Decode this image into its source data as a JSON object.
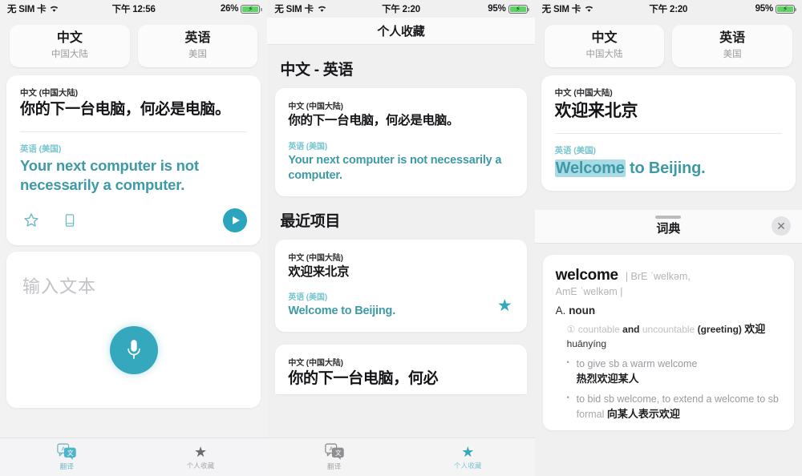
{
  "panels": [
    {
      "status": {
        "carrier": "无 SIM 卡",
        "time": "下午 12:56",
        "battery": "26%"
      },
      "lang_from": {
        "name": "中文",
        "region": "中国大陆"
      },
      "lang_to": {
        "name": "英语",
        "region": "美国"
      },
      "card": {
        "source_label": "中文 (中国大陆)",
        "source_text": "你的下一台电脑，何必是电脑。",
        "target_label": "英语 (美国)",
        "target_text": "Your next computer is not necessarily a computer."
      },
      "actions": {
        "favorite": "star-outline-icon",
        "dictionary": "book-icon",
        "play": "play-icon"
      },
      "input": {
        "placeholder": "输入文本",
        "mic": "microphone-icon"
      },
      "tabs": [
        {
          "label": "翻译",
          "icon": "translate-icon",
          "active": true
        },
        {
          "label": "个人收藏",
          "icon": "star-icon",
          "active": false
        }
      ]
    },
    {
      "status": {
        "carrier": "无 SIM 卡",
        "time": "下午 2:20",
        "battery": "95%"
      },
      "nav_title": "个人收藏",
      "section_pair": "中文 - 英语",
      "saved_card": {
        "source_label": "中文 (中国大陆)",
        "source_text": "你的下一台电脑，何必是电脑。",
        "target_label": "英语 (美国)",
        "target_text": "Your next computer is not necessarily a computer."
      },
      "section_recent": "最近项目",
      "recent_items": [
        {
          "source_label": "中文 (中国大陆)",
          "source_text": "欢迎来北京",
          "target_label": "英语 (美国)",
          "target_text": "Welcome to Beijing.",
          "starred": true
        },
        {
          "source_label": "中文 (中国大陆)",
          "source_text": "你的下一台电脑，何必"
        }
      ],
      "tabs": [
        {
          "label": "翻译",
          "icon": "translate-icon",
          "active": false
        },
        {
          "label": "个人收藏",
          "icon": "star-icon",
          "active": true
        }
      ]
    },
    {
      "status": {
        "carrier": "无 SIM 卡",
        "time": "下午 2:20",
        "battery": "95%"
      },
      "lang_from": {
        "name": "中文",
        "region": "中国大陆"
      },
      "lang_to": {
        "name": "英语",
        "region": "美国"
      },
      "card": {
        "source_label": "中文 (中国大陆)",
        "source_text": "欢迎来北京",
        "target_label": "英语 (美国)",
        "target_text_highlight": "Welcome",
        "target_text_rest": " to Beijing."
      },
      "sheet": {
        "title": "词典",
        "close": "close-icon"
      },
      "dictionary": {
        "word": "welcome",
        "phonetic_bre": "| BrE ˈwelkəm,",
        "phonetic_ame": "AmE ˈwelkəm |",
        "pos_letter": "A.",
        "pos": "noun",
        "sense_number": "①",
        "sense_grammar_1": "countable",
        "sense_and": "and",
        "sense_grammar_2": "uncountable",
        "sense_context": "(greeting)",
        "sense_cn": "欢迎",
        "sense_pinyin": "huānyíng",
        "examples": [
          {
            "en": "to give sb a warm welcome",
            "cn": "热烈欢迎某人"
          },
          {
            "en": "to bid sb welcome, to extend a welcome to sb",
            "formal_label": "formal",
            "cn": "向某人表示欢迎"
          }
        ]
      }
    }
  ],
  "colors": {
    "accent": "#35a8bd",
    "teal_text": "#3e9aa6",
    "highlight": "#a9dbe6",
    "page_bg": "#f0f0f1",
    "card_bg": "#ffffff"
  }
}
